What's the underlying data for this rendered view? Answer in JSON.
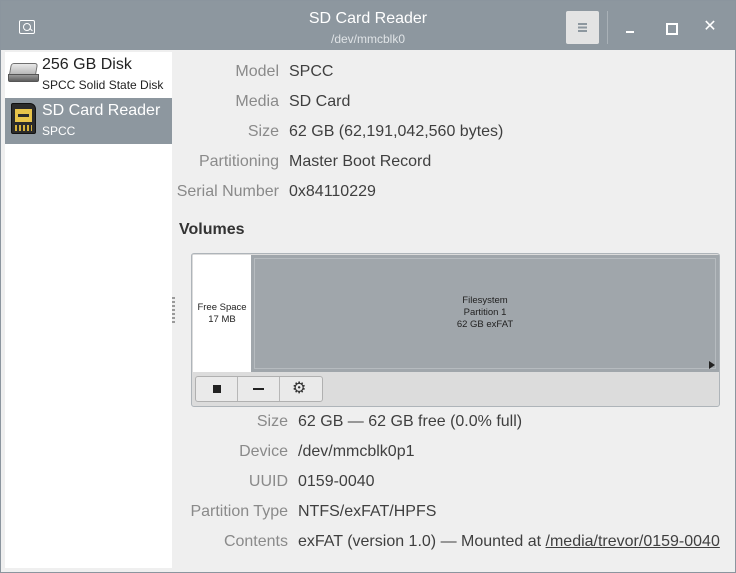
{
  "window": {
    "title": "SD Card Reader",
    "subtitle": "/dev/mmcblk0",
    "close_glyph": "✕"
  },
  "drives": [
    {
      "name": "256 GB Disk",
      "description": "SPCC Solid State Disk",
      "icon": "hard-disk-icon",
      "selected": false
    },
    {
      "name": "SD Card Reader",
      "description": "SPCC",
      "icon": "sd-card-icon",
      "selected": true
    }
  ],
  "details": {
    "model_label": "Model",
    "model": "SPCC",
    "media_label": "Media",
    "media": "SD Card",
    "size_label": "Size",
    "size": "62 GB (62,191,042,560 bytes)",
    "partitioning_label": "Partitioning",
    "partitioning": "Master Boot Record",
    "serial_label": "Serial Number",
    "serial": "0x84110229"
  },
  "volumes": {
    "heading": "Volumes",
    "free_segment": {
      "line1": "Free Space",
      "line2": "17 MB"
    },
    "fs_segment": {
      "line1": "Filesystem",
      "line2": "Partition 1",
      "line3": "62 GB exFAT"
    }
  },
  "volume_details": {
    "size_label": "Size",
    "size": "62 GB — 62 GB free (0.0% full)",
    "device_label": "Device",
    "device": "/dev/mmcblk0p1",
    "uuid_label": "UUID",
    "uuid": "0159-0040",
    "ptype_label": "Partition Type",
    "ptype": "NTFS/exFAT/HPFS",
    "contents_label": "Contents",
    "contents_prefix": "exFAT (version 1.0) — Mounted at ",
    "mount_path": "/media/trevor/0159-0040"
  },
  "colors": {
    "titlebar": "#8d979f",
    "selected_row": "#8d979f",
    "partition_fill": "#a0a6ab"
  }
}
